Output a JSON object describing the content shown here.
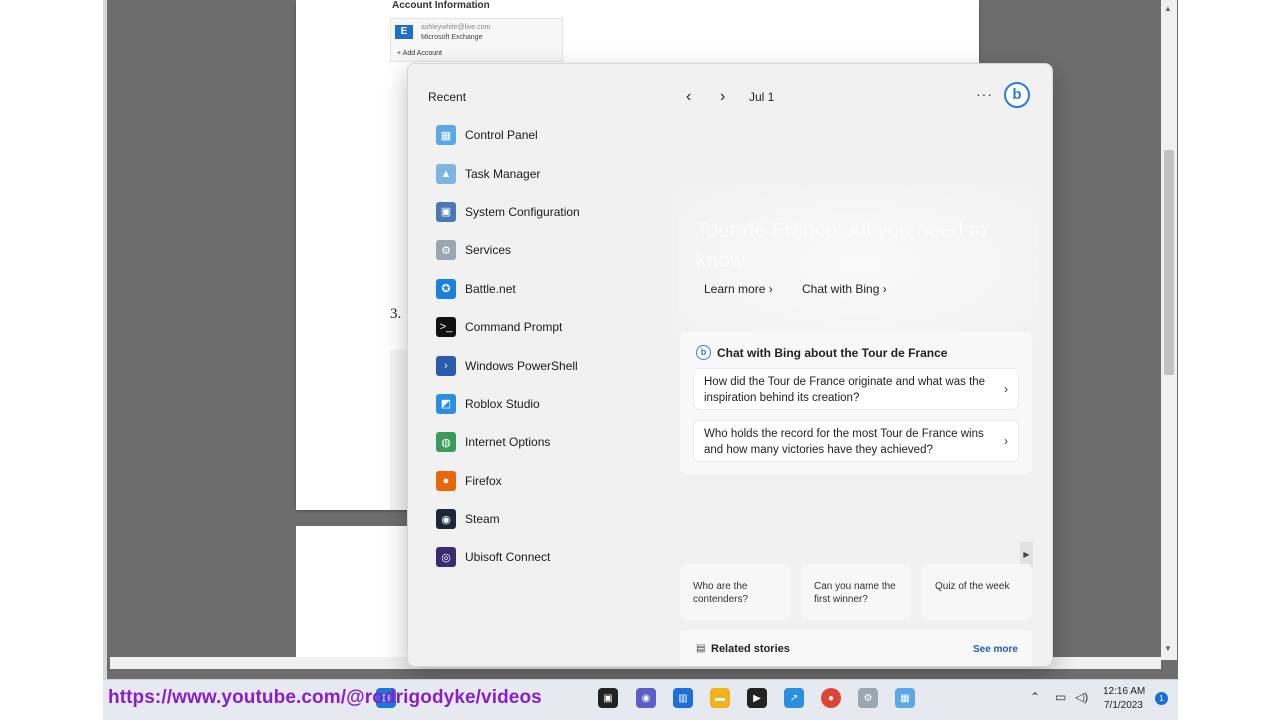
{
  "document": {
    "account_title": "Account Information",
    "account_email": "ashleywhite@live.com",
    "account_type": "Microsoft Exchange",
    "add_account": "Add Account",
    "step_number": "3."
  },
  "widgets": {
    "recent_title": "Recent",
    "date_label": "Jul 1",
    "more_label": "···",
    "bing_logo": "b",
    "recent_apps": [
      {
        "label": "Control Panel",
        "icon": "control-panel-icon",
        "color": "#5aa9e6",
        "glyph": "▦"
      },
      {
        "label": "Task Manager",
        "icon": "task-manager-icon",
        "color": "#7fb4df",
        "glyph": "▲"
      },
      {
        "label": "System Configuration",
        "icon": "system-configuration-icon",
        "color": "#4a78b5",
        "glyph": "▣"
      },
      {
        "label": "Services",
        "icon": "services-icon",
        "color": "#9aa7b3",
        "glyph": "⚙"
      },
      {
        "label": "Battle.net",
        "icon": "battlenet-icon",
        "color": "#1b7fe0",
        "glyph": "✪"
      },
      {
        "label": "Command Prompt",
        "icon": "command-prompt-icon",
        "color": "#111111",
        "glyph": ">_"
      },
      {
        "label": "Windows PowerShell",
        "icon": "powershell-icon",
        "color": "#2b5cab",
        "glyph": "›"
      },
      {
        "label": "Roblox Studio",
        "icon": "roblox-studio-icon",
        "color": "#2a8fdd",
        "glyph": "◩"
      },
      {
        "label": "Internet Options",
        "icon": "internet-options-icon",
        "color": "#3a9b5a",
        "glyph": "◍"
      },
      {
        "label": "Firefox",
        "icon": "firefox-icon",
        "color": "#e8660d",
        "glyph": "●"
      },
      {
        "label": "Steam",
        "icon": "steam-icon",
        "color": "#1b2838",
        "glyph": "◉"
      },
      {
        "label": "Ubisoft Connect",
        "icon": "ubisoft-connect-icon",
        "color": "#3a2c6e",
        "glyph": "◎"
      }
    ],
    "hero_title": "Tour de France: All you need to know",
    "learn_more": "Learn more",
    "chat_with_bing": "Chat with Bing",
    "chat_card": {
      "heading": "Chat with Bing about the Tour de France",
      "questions": [
        "How did the Tour de France originate and what was the inspiration behind its creation?",
        "Who holds the record for the most Tour de France wins and how many victories have they achieved?"
      ]
    },
    "suggestions": [
      "Who are the contenders?",
      "Can you name the first winner?",
      "Quiz of the week"
    ],
    "related_title": "Related stories",
    "see_more": "See more"
  },
  "overlay": {
    "youtube_url": "https://www.youtube.com/@rodrigodyke/videos"
  },
  "taskbar": {
    "clock_time": "12:16 AM",
    "clock_date": "7/1/2023",
    "notification_count": "1"
  }
}
